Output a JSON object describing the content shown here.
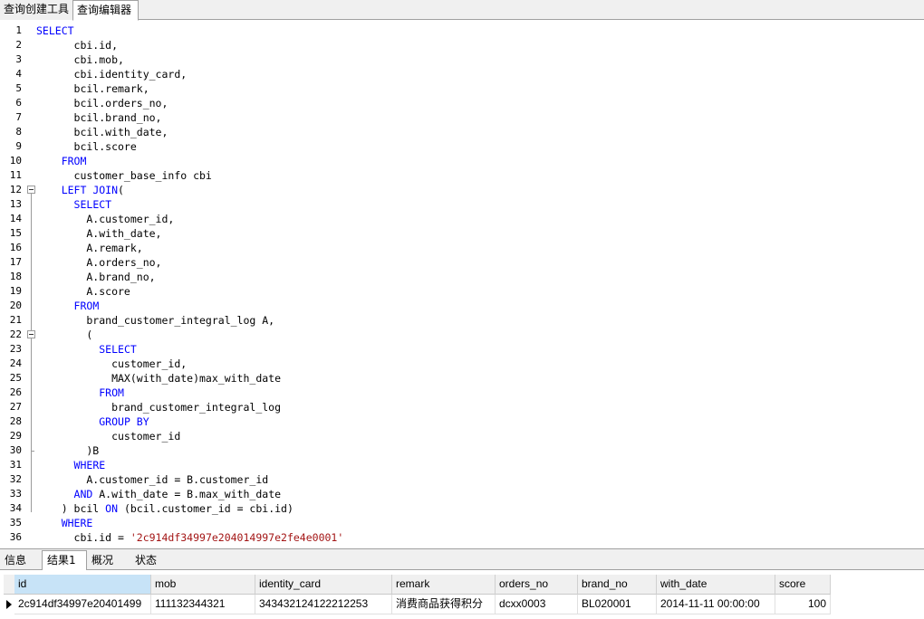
{
  "top_tabs": [
    "查询创建工具",
    "查询编辑器"
  ],
  "active_top_tab": 1,
  "code_lines": [
    [
      [
        "kw",
        "SELECT"
      ]
    ],
    [
      [
        "txt",
        "      cbi.id,"
      ]
    ],
    [
      [
        "txt",
        "      cbi.mob,"
      ]
    ],
    [
      [
        "txt",
        "      cbi.identity_card,"
      ]
    ],
    [
      [
        "txt",
        "      bcil.remark,"
      ]
    ],
    [
      [
        "txt",
        "      bcil.orders_no,"
      ]
    ],
    [
      [
        "txt",
        "      bcil.brand_no,"
      ]
    ],
    [
      [
        "txt",
        "      bcil.with_date,"
      ]
    ],
    [
      [
        "txt",
        "      bcil.score"
      ]
    ],
    [
      [
        "txt",
        "    "
      ],
      [
        "kw",
        "FROM"
      ]
    ],
    [
      [
        "txt",
        "      customer_base_info cbi"
      ]
    ],
    [
      [
        "txt",
        "    "
      ],
      [
        "kw",
        "LEFT JOIN"
      ],
      [
        "txt",
        "("
      ]
    ],
    [
      [
        "txt",
        "      "
      ],
      [
        "kw",
        "SELECT"
      ]
    ],
    [
      [
        "txt",
        "        A.customer_id,"
      ]
    ],
    [
      [
        "txt",
        "        A.with_date,"
      ]
    ],
    [
      [
        "txt",
        "        A.remark,"
      ]
    ],
    [
      [
        "txt",
        "        A.orders_no,"
      ]
    ],
    [
      [
        "txt",
        "        A.brand_no,"
      ]
    ],
    [
      [
        "txt",
        "        A.score"
      ]
    ],
    [
      [
        "txt",
        "      "
      ],
      [
        "kw",
        "FROM"
      ]
    ],
    [
      [
        "txt",
        "        brand_customer_integral_log A,"
      ]
    ],
    [
      [
        "txt",
        "        ("
      ]
    ],
    [
      [
        "txt",
        "          "
      ],
      [
        "kw",
        "SELECT"
      ]
    ],
    [
      [
        "txt",
        "            customer_id,"
      ]
    ],
    [
      [
        "txt",
        "            MAX(with_date)max_with_date"
      ]
    ],
    [
      [
        "txt",
        "          "
      ],
      [
        "kw",
        "FROM"
      ]
    ],
    [
      [
        "txt",
        "            brand_customer_integral_log"
      ]
    ],
    [
      [
        "txt",
        "          "
      ],
      [
        "kw",
        "GROUP BY"
      ]
    ],
    [
      [
        "txt",
        "            customer_id"
      ]
    ],
    [
      [
        "txt",
        "        )B"
      ]
    ],
    [
      [
        "txt",
        "      "
      ],
      [
        "kw",
        "WHERE"
      ]
    ],
    [
      [
        "txt",
        "        A.customer_id = B.customer_id"
      ]
    ],
    [
      [
        "txt",
        "      "
      ],
      [
        "kw",
        "AND"
      ],
      [
        "txt",
        " A.with_date = B.max_with_date"
      ]
    ],
    [
      [
        "txt",
        "    ) bcil "
      ],
      [
        "kw",
        "ON"
      ],
      [
        "txt",
        " (bcil.customer_id = cbi.id)"
      ]
    ],
    [
      [
        "txt",
        "    "
      ],
      [
        "kw",
        "WHERE"
      ]
    ],
    [
      [
        "txt",
        "      cbi.id = "
      ],
      [
        "str",
        "'2c914df34997e204014997e2fe4e0001'"
      ]
    ]
  ],
  "bottom_tabs": [
    "信息",
    "结果1",
    "概况",
    "状态"
  ],
  "active_bottom_tab": 1,
  "result_columns": [
    "id",
    "mob",
    "identity_card",
    "remark",
    "orders_no",
    "brand_no",
    "with_date",
    "score"
  ],
  "result_rows": [
    [
      "2c914df34997e20401499",
      "111132344321",
      "343432124122212253",
      "消费商品获得积分",
      "dcxx0003",
      "BL020001",
      "2014-11-11 00:00:00",
      "100"
    ]
  ],
  "colors": {
    "keyword": "#0000ff",
    "string": "#a31515",
    "selected_header": "#c7e3f7"
  }
}
